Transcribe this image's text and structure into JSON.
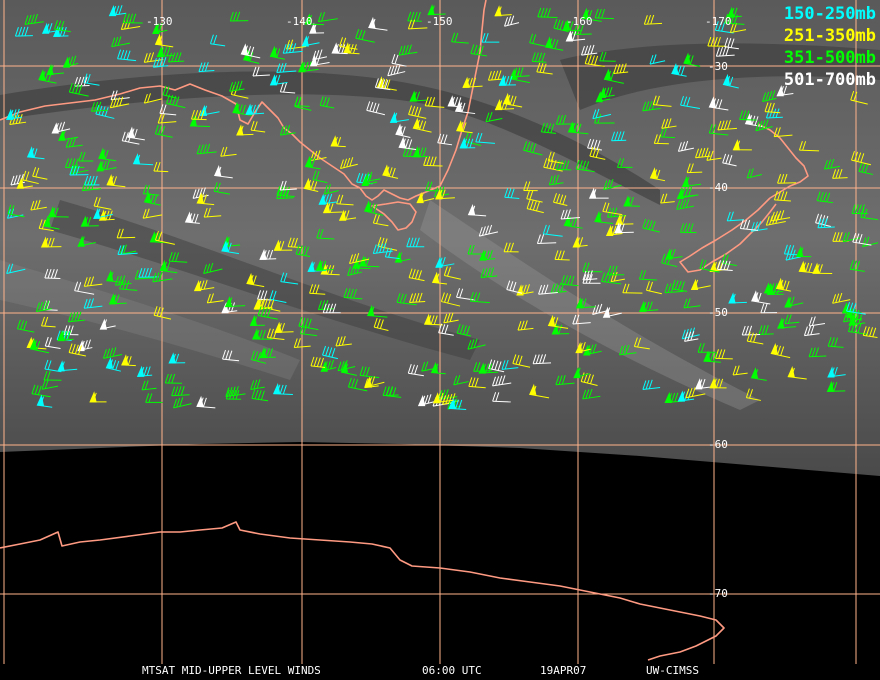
{
  "map": {
    "projection_note": "",
    "background_color": "#000000",
    "graticule_color": "#ffb38a",
    "coastline_color": "#ff9a82",
    "longitude_labels": [
      "-130",
      "-140",
      "-150",
      "-160",
      "-170"
    ],
    "latitude_labels": [
      "-30",
      "-40",
      "-50",
      "-60",
      "-70"
    ]
  },
  "legend": {
    "items": [
      {
        "label": "150-250mb",
        "color": "#00ffff"
      },
      {
        "label": "251-350mb",
        "color": "#ffff00"
      },
      {
        "label": "351-500mb",
        "color": "#00ff00"
      },
      {
        "label": "501-700mb",
        "color": "#ffffff"
      }
    ]
  },
  "footer": {
    "product": "MTSAT MID-UPPER LEVEL WINDS",
    "time": "06:00 UTC",
    "date": "19APR07",
    "source": "UW-CIMSS"
  }
}
